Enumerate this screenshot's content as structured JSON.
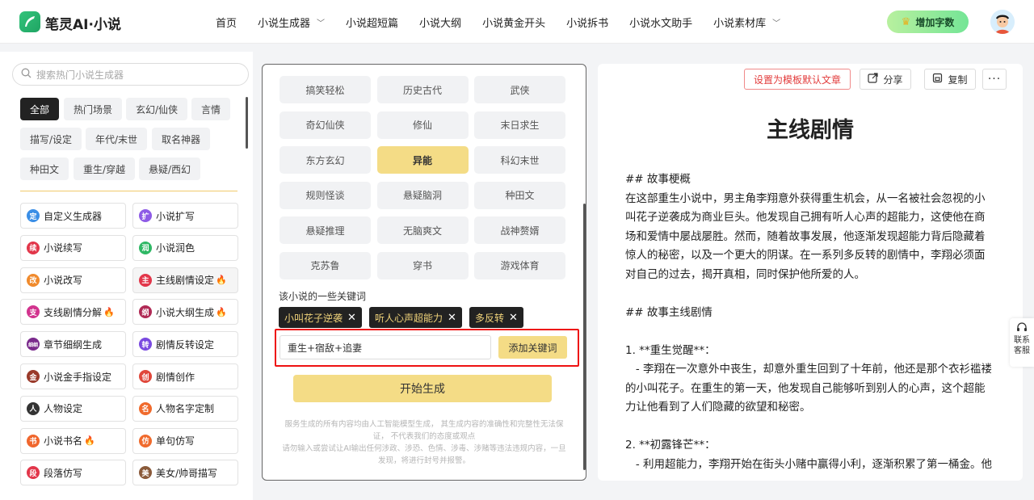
{
  "header": {
    "brand": "笔灵AI·小说",
    "nav": [
      {
        "label": "首页",
        "dropdown": false
      },
      {
        "label": "小说生成器",
        "dropdown": true
      },
      {
        "label": "小说超短篇",
        "dropdown": false
      },
      {
        "label": "小说大纲",
        "dropdown": false
      },
      {
        "label": "小说黄金开头",
        "dropdown": false
      },
      {
        "label": "小说拆书",
        "dropdown": false
      },
      {
        "label": "小说水文助手",
        "dropdown": false
      },
      {
        "label": "小说素材库",
        "dropdown": true
      }
    ],
    "add_words_label": "增加字数"
  },
  "sidebar": {
    "search_placeholder": "搜索热门小说生成器",
    "categories": [
      "全部",
      "热门场景",
      "玄幻/仙侠",
      "言情",
      "描写/设定",
      "年代/末世",
      "取名神器",
      "种田文",
      "重生/穿越",
      "悬疑/西幻"
    ],
    "tools": [
      {
        "label": "自定义生成器",
        "icon": "定",
        "color": "#3a8ee6",
        "fire": false
      },
      {
        "label": "小说扩写",
        "icon": "扩",
        "color": "#8e5be6",
        "fire": false
      },
      {
        "label": "小说续写",
        "icon": "续",
        "color": "#e2364a",
        "fire": false
      },
      {
        "label": "小说润色",
        "icon": "润",
        "color": "#2fb865",
        "fire": false
      },
      {
        "label": "小说改写",
        "icon": "改",
        "color": "#f08a2c",
        "fire": false
      },
      {
        "label": "主线剧情设定",
        "icon": "主",
        "color": "#e2364a",
        "fire": true
      },
      {
        "label": "支线剧情分解",
        "icon": "支",
        "color": "#d2338e",
        "fire": true
      },
      {
        "label": "小说大纲生成",
        "icon": "纲",
        "color": "#b02a55",
        "fire": true
      },
      {
        "label": "章节细纲生成",
        "icon": "细纲",
        "color": "#7a2a8c",
        "fire": false
      },
      {
        "label": "剧情反转设定",
        "icon": "转",
        "color": "#7a4ae0",
        "fire": false
      },
      {
        "label": "小说金手指设定",
        "icon": "金",
        "color": "#9a3a2a",
        "fire": false
      },
      {
        "label": "剧情创作",
        "icon": "创",
        "color": "#e0473a",
        "fire": false
      },
      {
        "label": "人物设定",
        "icon": "人",
        "color": "#333333",
        "fire": false
      },
      {
        "label": "人物名字定制",
        "icon": "名",
        "color": "#f06a2c",
        "fire": false
      },
      {
        "label": "小说书名",
        "icon": "书",
        "color": "#f0662d",
        "fire": true
      },
      {
        "label": "单句仿写",
        "icon": "仿",
        "color": "#f06a2c",
        "fire": false
      },
      {
        "label": "段落仿写",
        "icon": "段",
        "color": "#e2364a",
        "fire": false
      },
      {
        "label": "美女/帅哥描写",
        "icon": "美",
        "color": "#8a5a3a",
        "fire": false
      }
    ]
  },
  "form": {
    "genres": [
      "搞笑轻松",
      "历史古代",
      "武侠",
      "奇幻仙侠",
      "修仙",
      "末日求生",
      "东方玄幻",
      "异能",
      "科幻末世",
      "规则怪谈",
      "悬疑脑洞",
      "种田文",
      "悬疑推理",
      "无脑爽文",
      "战神赘婿",
      "克苏鲁",
      "穿书",
      "游戏体育"
    ],
    "selected_genre": "异能",
    "keywords_title": "该小说的一些关键词",
    "keywords": [
      "小叫花子逆袭",
      "听人心声超能力",
      "多反转"
    ],
    "keyword_input_value": "重生+宿敌+追妻",
    "add_keyword_label": "添加关键词",
    "start_label": "开始生成",
    "disclaimer_lines": [
      "服务生成的所有内容均由人工智能模型生成， 其生成内容的准确性和完整性无法保证， 不代表我们的态度或观点",
      "请勿输入或尝试让AI输出任何涉政、涉恐、色情、涉毒、涉赌等违法违规内容，一旦发现，将进行封号并报警。"
    ]
  },
  "result": {
    "set_default_label": "设置为模板默认文章",
    "share_label": "分享",
    "copy_label": "复制",
    "title": "主线剧情",
    "paragraphs": [
      "## 故事梗概",
      "在这部重生小说中，男主角李翔意外获得重生机会，从一名被社会忽视的小叫花子逆袭成为商业巨头。他发现自己拥有听人心声的超能力，这使他在商场和爱情中屡战屡胜。然而，随着故事发展，他逐渐发现超能力背后隐藏着惊人的秘密，以及一个更大的阴谋。在一系列多反转的剧情中，李翔必须面对自己的过去，揭开真相，同时保护他所爱的人。",
      "",
      "## 故事主线剧情",
      "",
      "1. **重生觉醒**：",
      "   - 李翔在一次意外中丧生，却意外重生回到了十年前，他还是那个衣衫褴褛的小叫花子。在重生的第一天，他发现自己能够听到别人的心声，这个超能力让他看到了人们隐藏的欲望和秘密。",
      "",
      "2. **初露锋芒**：",
      "   - 利用超能力，李翔开始在街头小赌中赢得小利，逐渐积累了第一桶金。他"
    ]
  },
  "contact": {
    "label_line1": "联系",
    "label_line2": "客服"
  }
}
